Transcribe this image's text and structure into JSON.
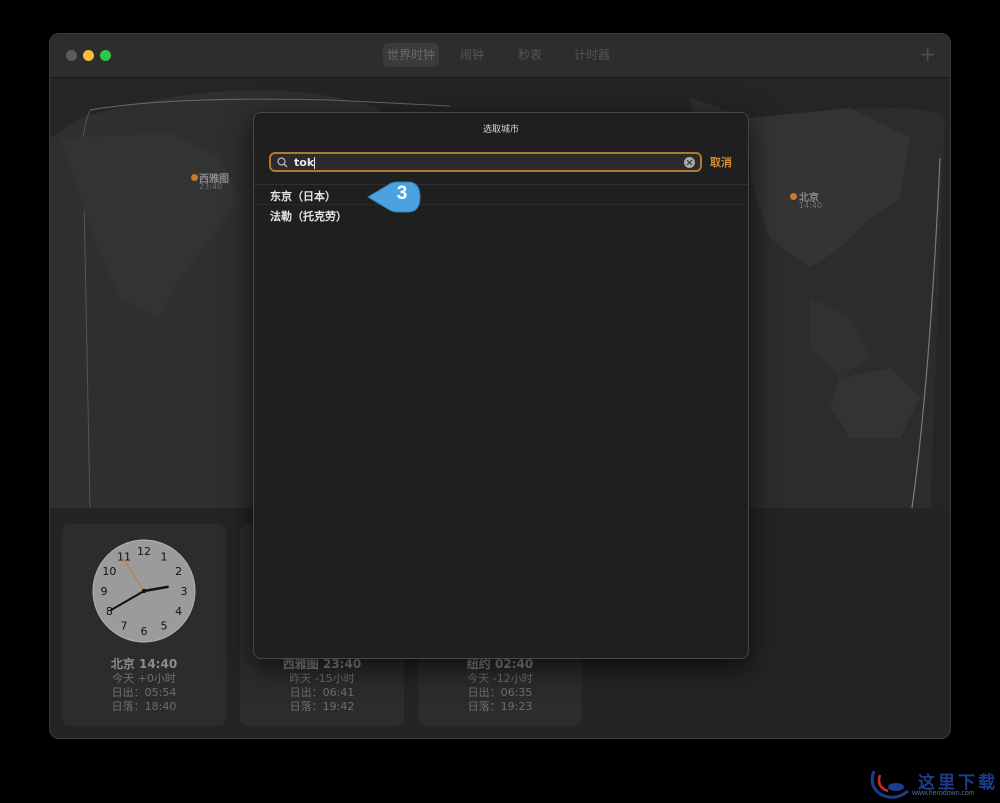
{
  "toolbar": {
    "tabs": [
      "世界时钟",
      "闹钟",
      "秒表",
      "计时器"
    ],
    "add_label": "+"
  },
  "map": {
    "pins": [
      {
        "name": "西雅图",
        "time": "23:40"
      },
      {
        "name": "北京",
        "time": "14:40"
      }
    ]
  },
  "clock": {
    "numbers": [
      "12",
      "1",
      "2",
      "3",
      "4",
      "5",
      "6",
      "7",
      "8",
      "9",
      "10",
      "11"
    ],
    "time": {
      "hour": 14,
      "minute": 40
    }
  },
  "cards": [
    {
      "title": "北京 14:40",
      "offset": "今天 +0小时",
      "sunrise": "日出：05:54",
      "sunset": "日落：18:40"
    },
    {
      "title": "西雅图 23:40",
      "offset": "昨天 -15小时",
      "sunrise": "日出：06:41",
      "sunset": "日落：19:42"
    },
    {
      "title": "纽约 02:40",
      "offset": "今天 -12小时",
      "sunrise": "日出：06:35",
      "sunset": "日落：19:23"
    }
  ],
  "sheet": {
    "title": "选取城市",
    "search_value": "tok",
    "cancel_label": "取消",
    "results": [
      "东京（日本）",
      "法勒（托克劳）"
    ]
  },
  "callout": {
    "number": "3",
    "color": "#4aa3df"
  },
  "watermark": {
    "text": "这里下载",
    "url": "www.herodown.com"
  },
  "colors": {
    "accent": "#d68a2c",
    "pin": "#c9782c"
  }
}
